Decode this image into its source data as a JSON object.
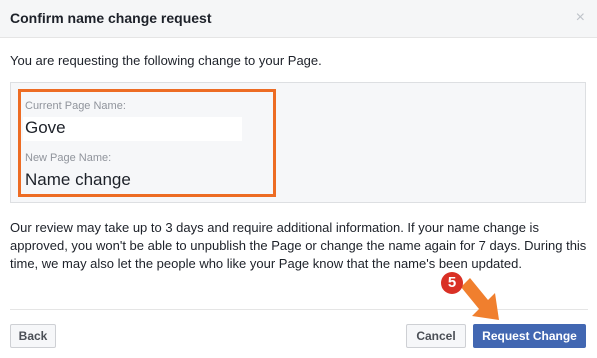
{
  "dialog": {
    "title": "Confirm name change request",
    "close_glyph": "×",
    "intro": "You are requesting the following change to your Page.",
    "current_label": "Current Page Name:",
    "current_value": "Gove",
    "new_label": "New Page Name:",
    "new_value": "Name change",
    "description": "Our review may take up to 3 days and require additional information. If your name change is approved, you won't be able to unpublish the Page or change the name again for 7 days. During this time, we may also let the people who like your Page know that the name's been updated.",
    "back_label": "Back",
    "cancel_label": "Cancel",
    "request_label": "Request Change"
  },
  "annotation": {
    "step_number": "5",
    "highlight_color": "#ed6c24",
    "arrow_color": "#f07f2e",
    "badge_color": "#d93025"
  },
  "colors": {
    "primary_button": "#4267b2",
    "header_bg": "#f5f6f7"
  }
}
